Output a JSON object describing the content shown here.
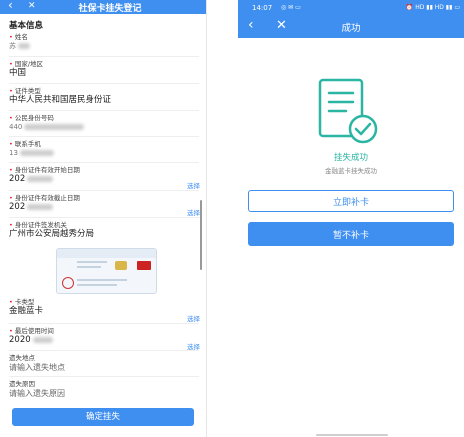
{
  "left": {
    "header": {
      "title": "社保卡挂失登记",
      "back_icon": "‹",
      "close_icon": "✕"
    },
    "section_title": "基本信息",
    "fields": {
      "name": {
        "label": "姓名",
        "value": "苏"
      },
      "country": {
        "label": "国家/地区",
        "value": "中国"
      },
      "id_type": {
        "label": "证件类型",
        "value": "中华人民共和国居民身份证"
      },
      "id_number": {
        "label": "公民身份号码",
        "value": "440"
      },
      "phone": {
        "label": "联系手机",
        "value": "13"
      },
      "valid_start": {
        "label": "身份证件有效开始日期",
        "value": "202",
        "action": "选择"
      },
      "valid_end": {
        "label": "身份证件有效截止日期",
        "value": "202",
        "action": "选择"
      },
      "issuer": {
        "label": "身份证件签发机关",
        "value": "广州市公安局越秀分局"
      },
      "card_type": {
        "label": "卡类型",
        "value": "金融蓝卡",
        "action": "选择"
      },
      "last_used": {
        "label": "最后使用时间",
        "value": "2020",
        "action": "选择"
      },
      "loss_place": {
        "label": "遗失地点",
        "placeholder": "请输入遗失地点"
      },
      "loss_reason": {
        "label": "遗失原因",
        "placeholder": "请输入遗失原因"
      }
    },
    "submit_label": "确定挂失"
  },
  "right": {
    "status_bar": {
      "time": "14:07",
      "left_icons": "◎ ✉ ▭",
      "right_icons": "⏰ HD ▮▮ HD ▮▮ ▭"
    },
    "nav": {
      "title": "成功",
      "back_icon": "‹",
      "close_icon": "✕"
    },
    "result_title": "挂失成功",
    "result_subtitle": "金融蓝卡挂失成功",
    "reissue_label": "立即补卡",
    "skip_label": "暂不补卡"
  },
  "colors": {
    "accent": "#3f8ff0",
    "success": "#2bb5a3"
  }
}
